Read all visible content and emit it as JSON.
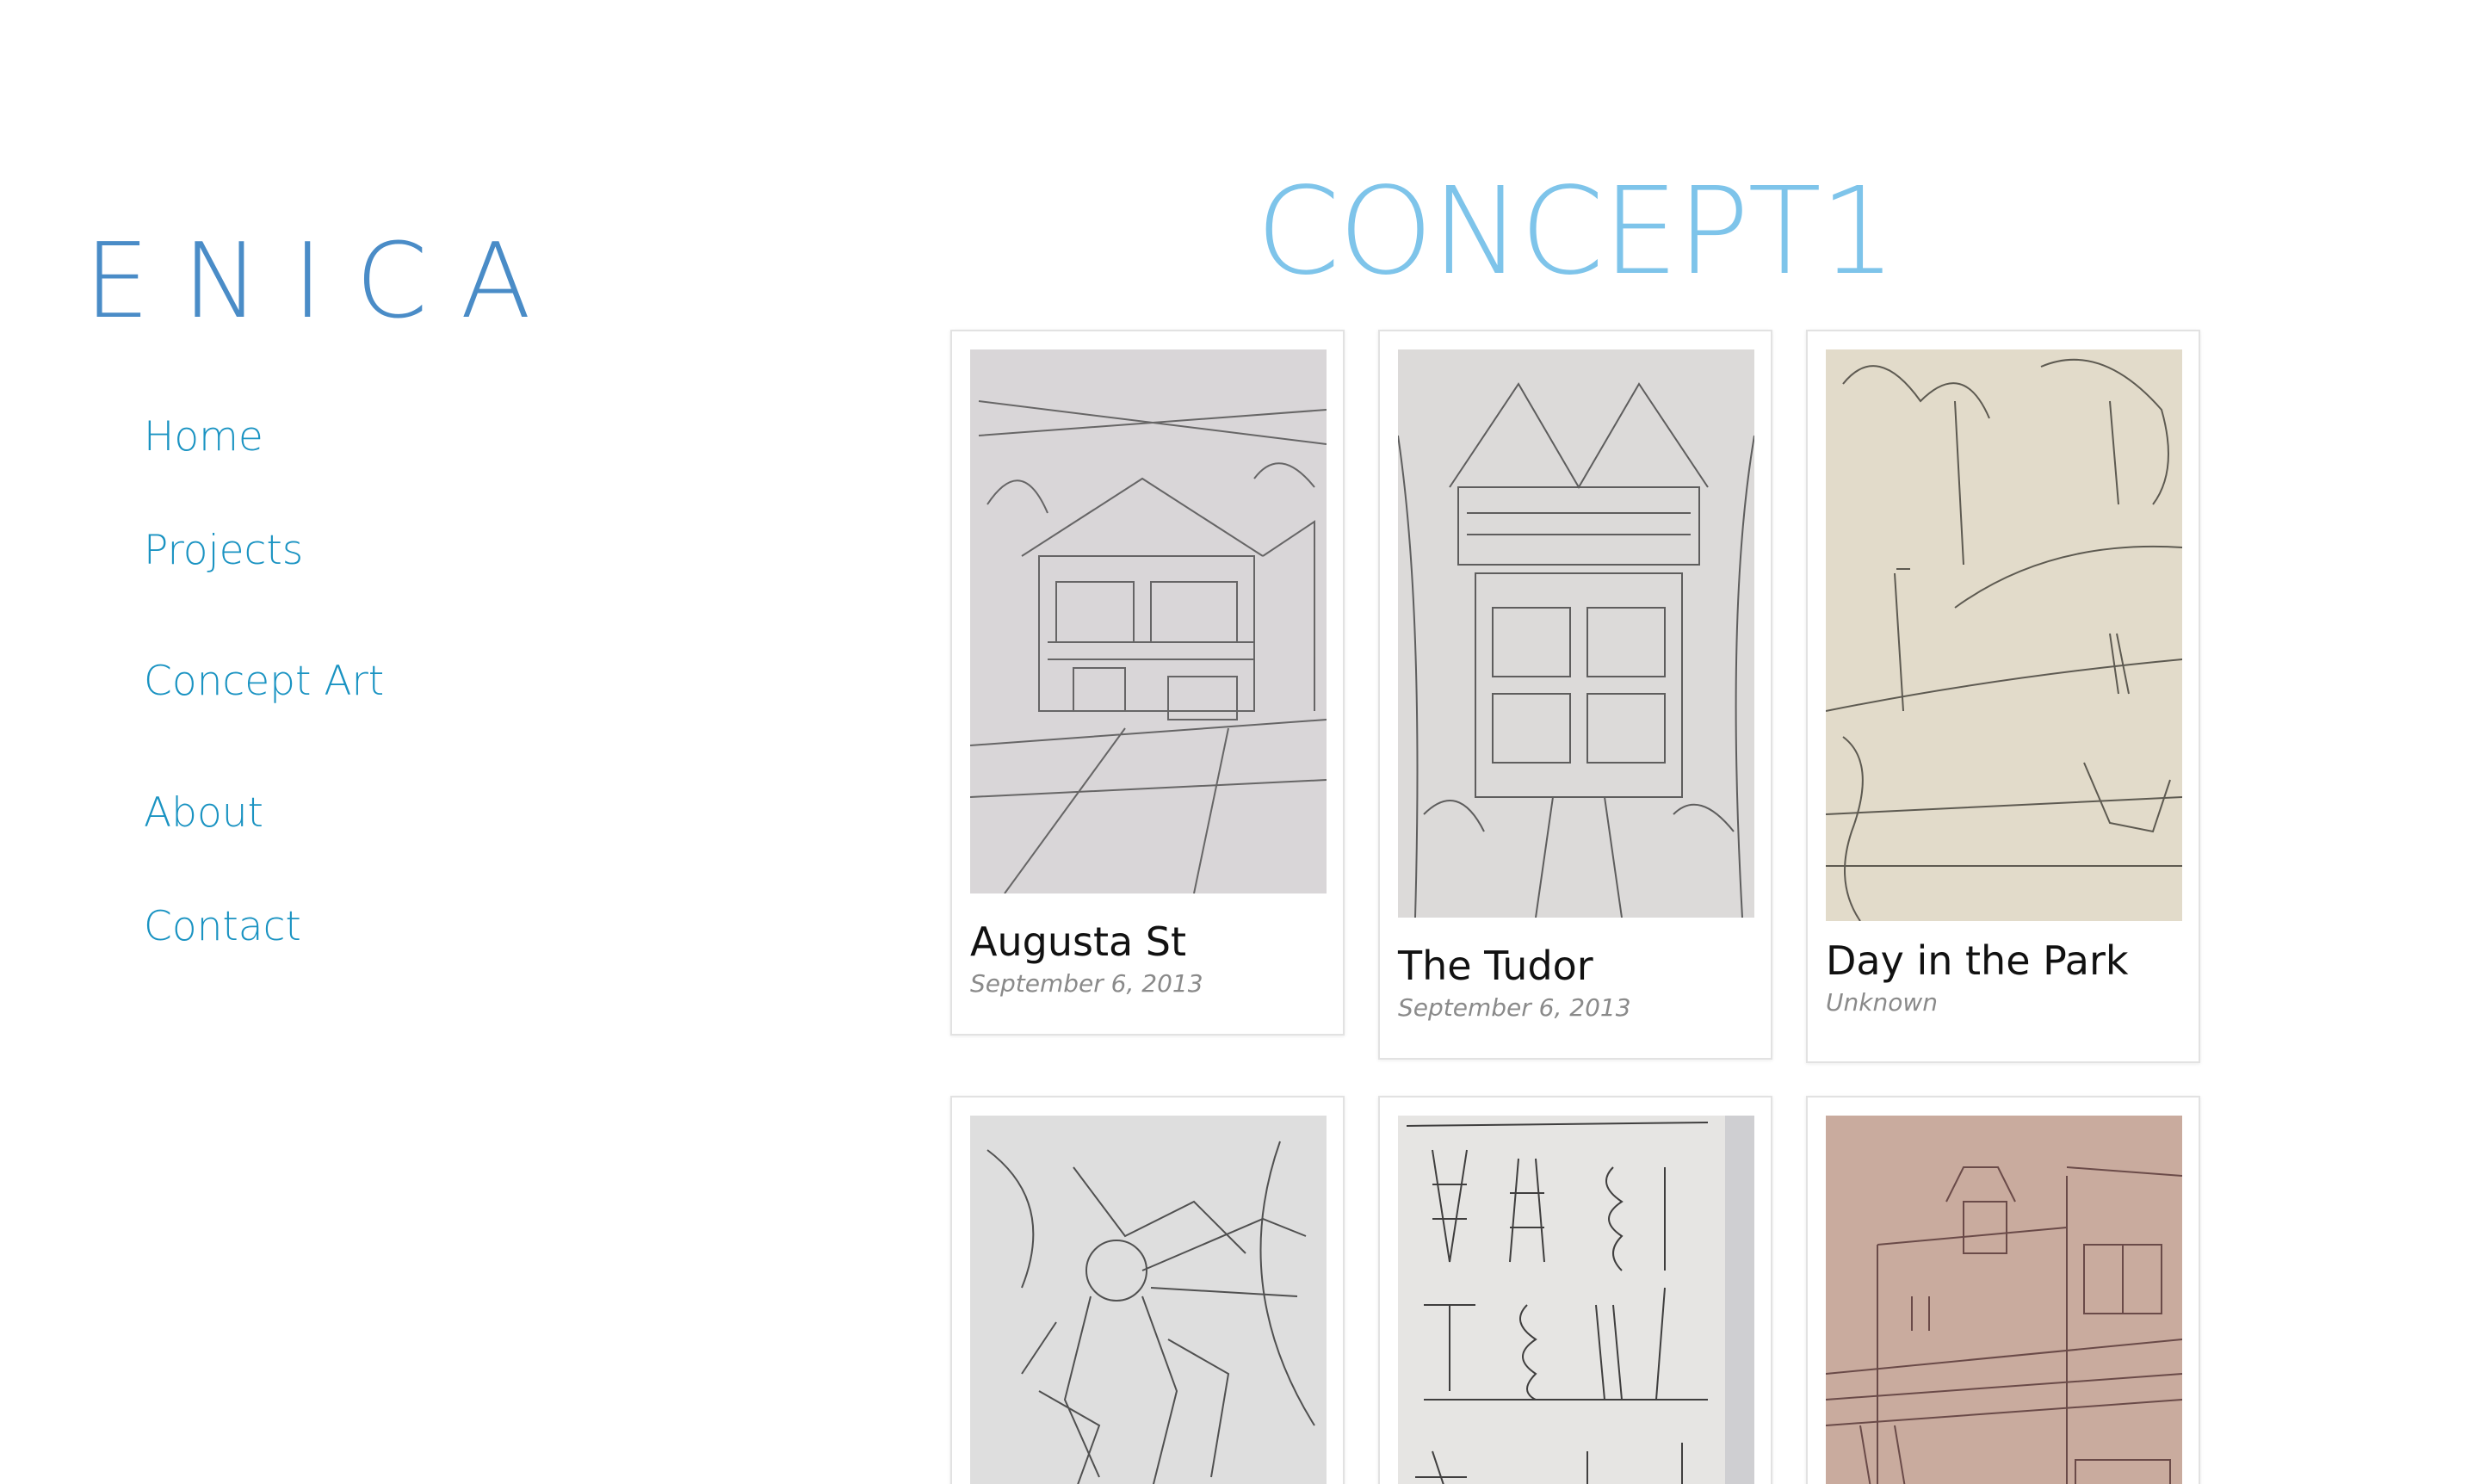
{
  "site": {
    "logo": "ENICA"
  },
  "nav": {
    "items": [
      {
        "label": "Home"
      },
      {
        "label": "Projects"
      },
      {
        "label": "Concept Art"
      },
      {
        "label": "About"
      },
      {
        "label": "Contact"
      }
    ]
  },
  "main": {
    "title": "CONCEPT1",
    "cards": [
      {
        "title": "Augusta St",
        "date": "September 6, 2013"
      },
      {
        "title": "The Tudor",
        "date": "September 6, 2013"
      },
      {
        "title": "Day in the Park",
        "date": "Unknown"
      },
      {
        "title": "",
        "date": ""
      },
      {
        "title": "",
        "date": ""
      },
      {
        "title": "",
        "date": ""
      }
    ]
  },
  "colors": {
    "logo": "#4a8cc7",
    "nav_link": "#1a93c2",
    "title": "#7ec4ea",
    "card_border": "#e2e2e2"
  },
  "icons": {
    "thumbnails": [
      "sketch-house-image",
      "sketch-tudor-image",
      "sketch-park-image",
      "sketch-robot-image",
      "sketch-towers-image",
      "sketch-street-image"
    ]
  }
}
